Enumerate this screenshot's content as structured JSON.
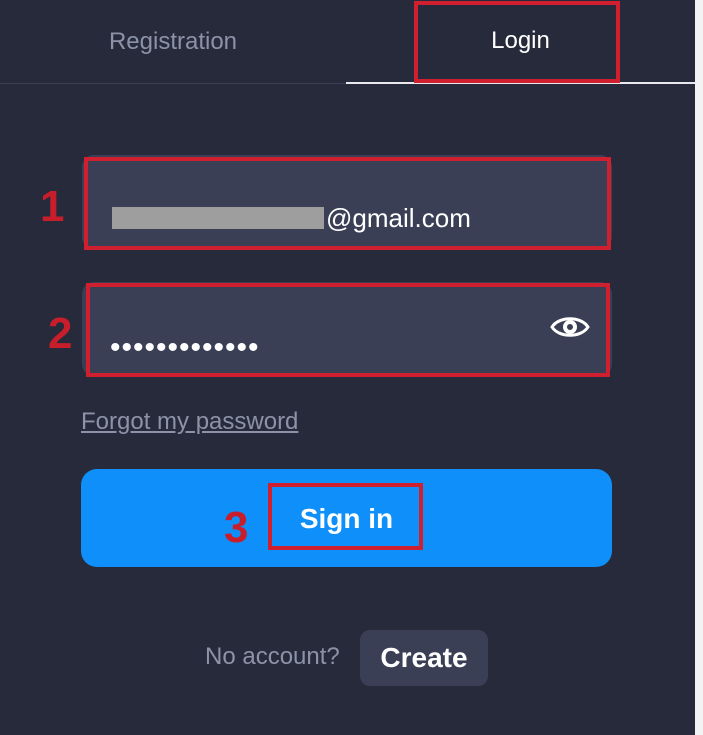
{
  "tabs": {
    "registration": "Registration",
    "login": "Login"
  },
  "form": {
    "email_value": "@gmail.com",
    "password_dots": "•••••••••••••",
    "forgot_label": "Forgot my password",
    "signin_label": "Sign in"
  },
  "footer": {
    "no_account_text": "No account?",
    "create_label": "Create"
  },
  "annotations": {
    "step1": "1",
    "step2": "2",
    "step3": "3"
  },
  "icons": {
    "password_toggle": "eye-icon"
  },
  "colors": {
    "background": "#262a3a",
    "field": "#3a3f55",
    "primary_button": "#0f8ff9",
    "muted_text": "#8c93a8",
    "annotation_red": "#d0202f"
  }
}
